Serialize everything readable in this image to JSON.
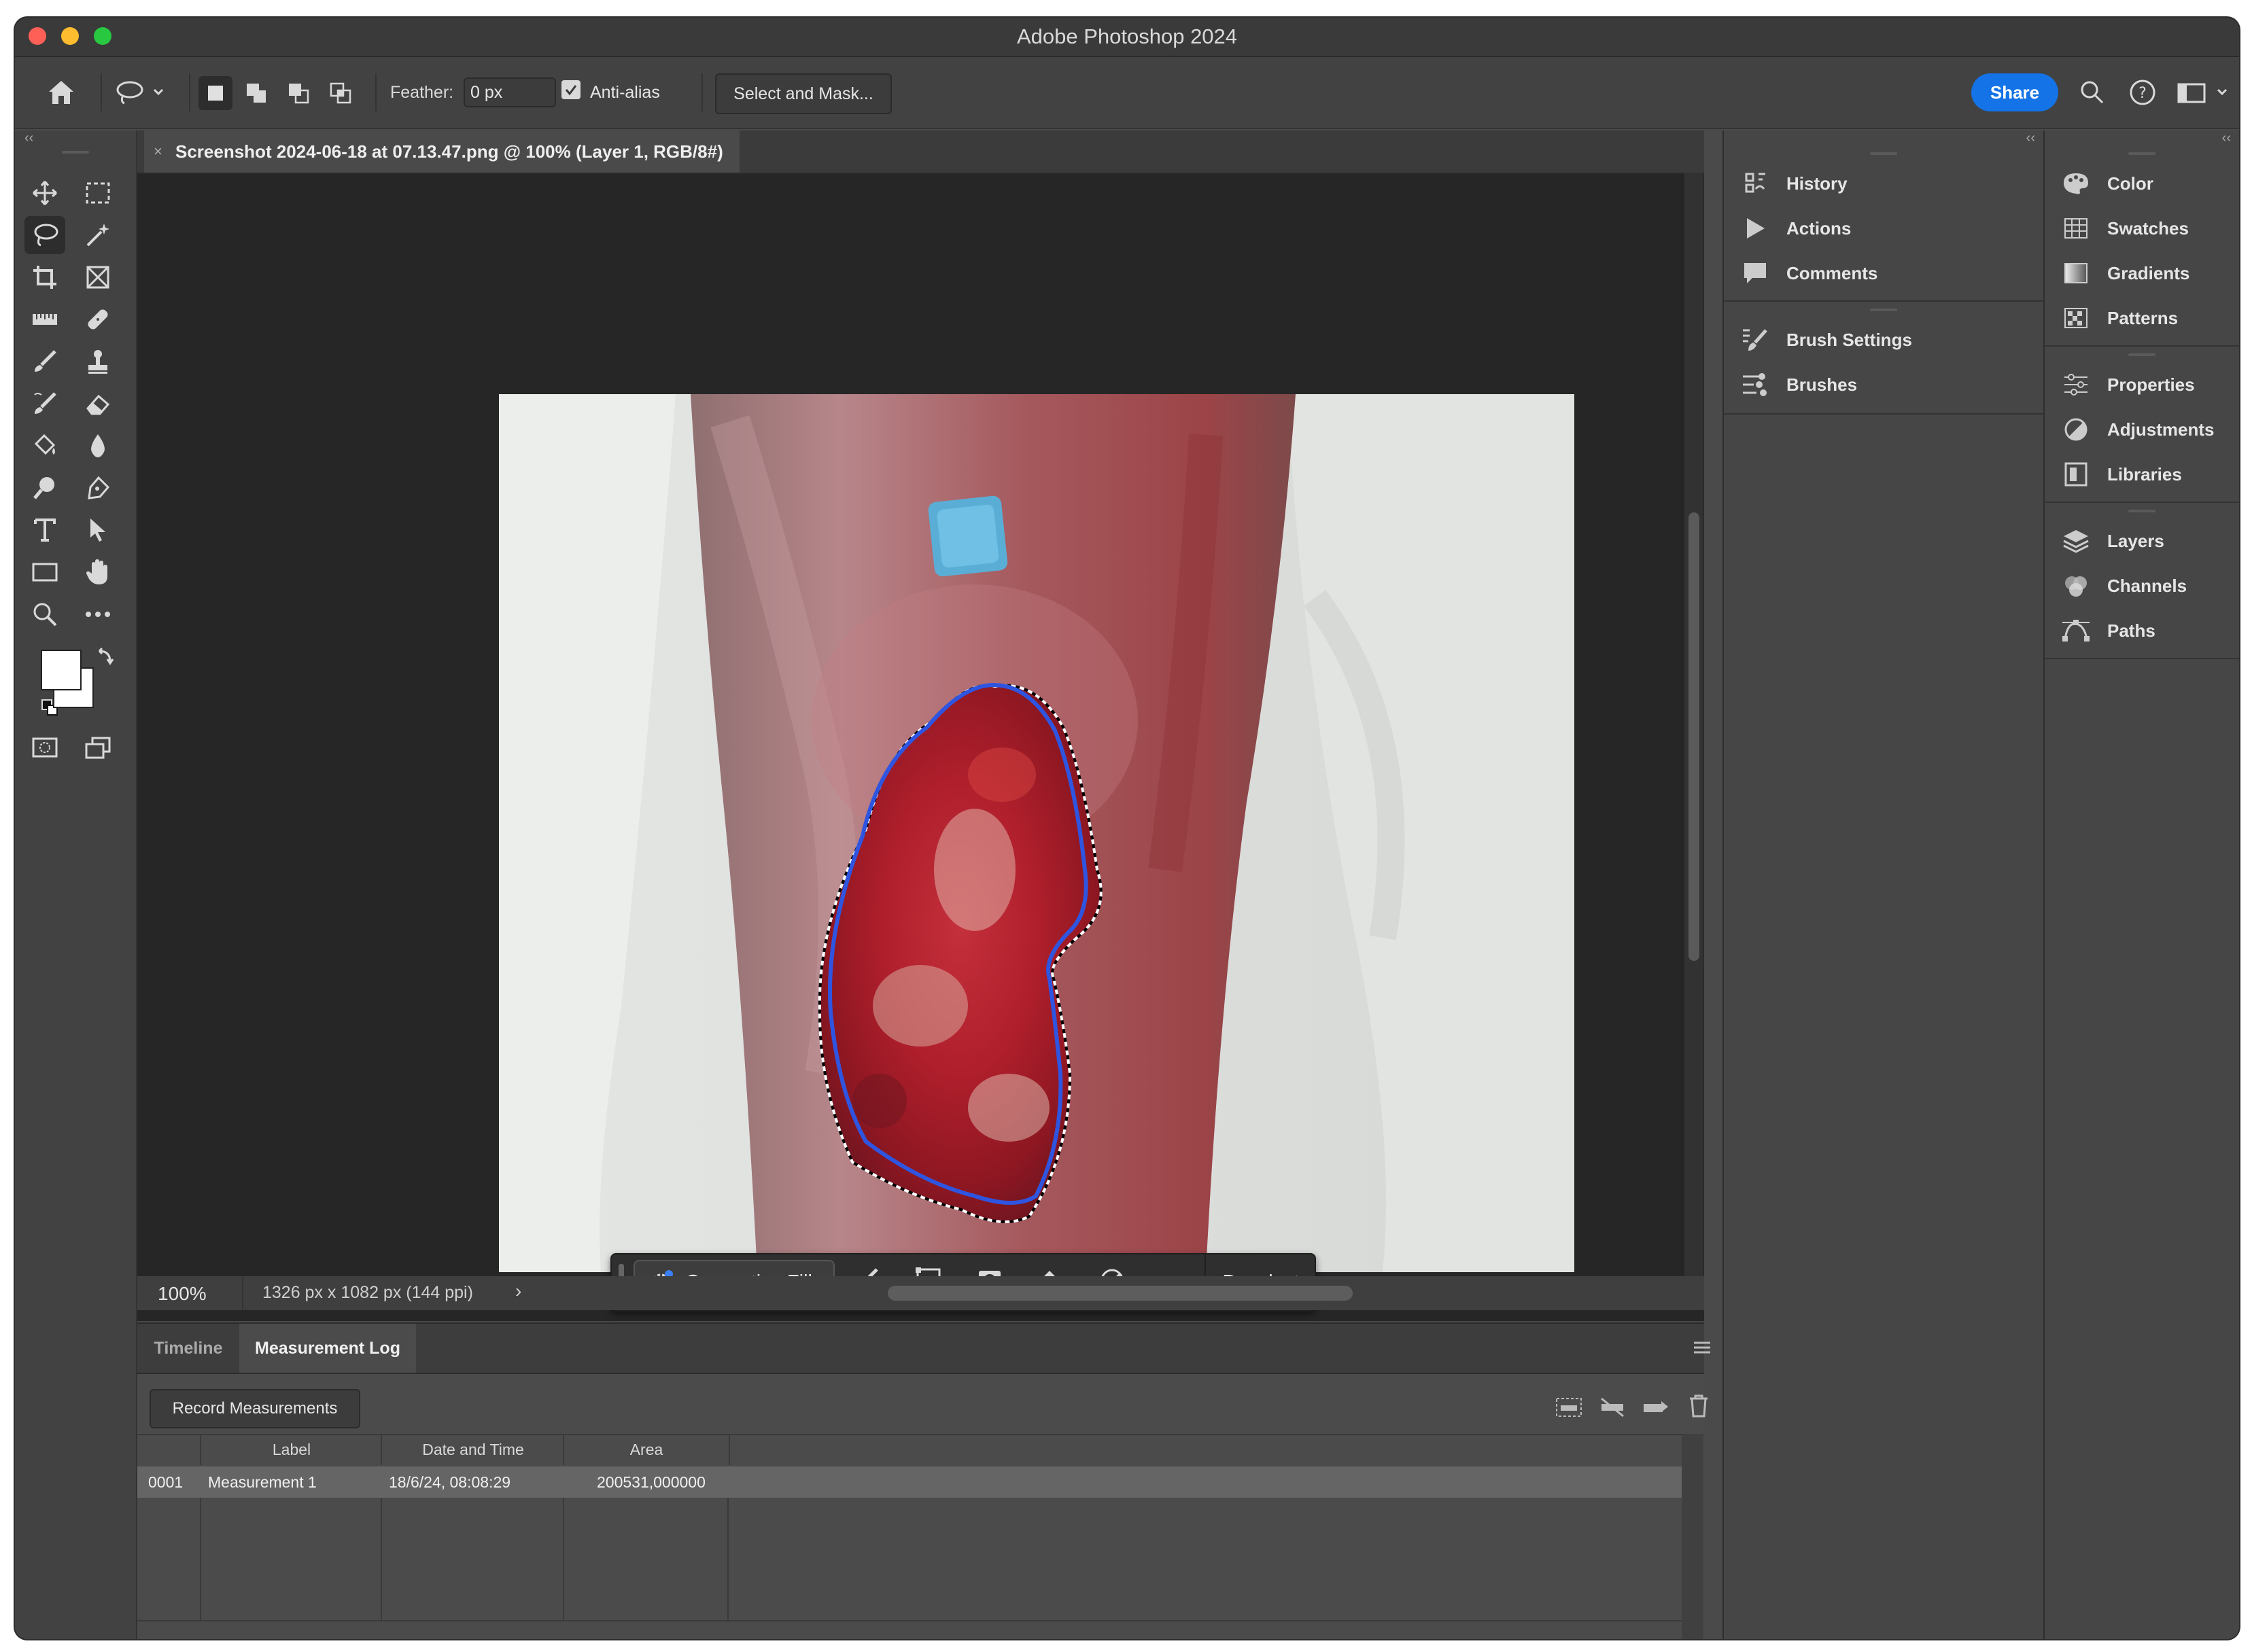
{
  "window": {
    "title": "Adobe Photoshop 2024"
  },
  "options_bar": {
    "feather_label": "Feather:",
    "feather_value": "0 px",
    "antialias_label": "Anti-alias",
    "antialias_checked": true,
    "select_and_mask": "Select and Mask...",
    "share": "Share"
  },
  "document": {
    "tab_title": "Screenshot 2024-06-18 at 07.13.47.png @ 100% (Layer 1, RGB/8#)",
    "zoom": "100%",
    "info": "1326 px x 1082 px (144 ppi)"
  },
  "context_bar": {
    "generative_fill": "Generative Fill",
    "deselect": "Deselect"
  },
  "bottom_panel": {
    "tabs": [
      "Timeline",
      "Measurement Log"
    ],
    "record_button": "Record Measurements",
    "columns": [
      "Label",
      "Date and Time",
      "Area"
    ],
    "rows": [
      {
        "id": "0001",
        "label": "Measurement 1",
        "datetime": "18/6/24, 08:08:29",
        "area": "200531,000000"
      }
    ]
  },
  "panels_mid": {
    "group1": [
      "History",
      "Actions",
      "Comments"
    ],
    "group2": [
      "Brush Settings",
      "Brushes"
    ]
  },
  "panels_right": {
    "group1": [
      "Color",
      "Swatches",
      "Gradients",
      "Patterns"
    ],
    "group2": [
      "Properties",
      "Adjustments",
      "Libraries"
    ],
    "group3": [
      "Layers",
      "Channels",
      "Paths"
    ]
  },
  "colors": {
    "accent": "#1473e6",
    "selection_outline": "#2f55e0",
    "wound": "#b3202b"
  }
}
